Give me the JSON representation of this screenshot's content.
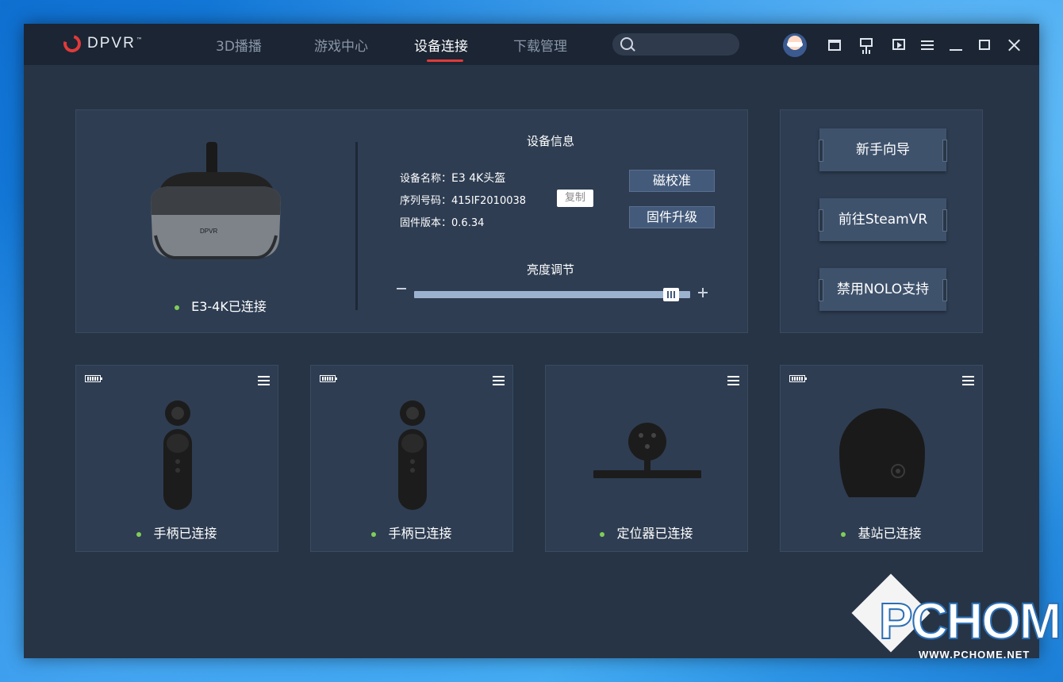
{
  "app": {
    "logo_text": "DPVR",
    "logo_tm": "™",
    "nav_tabs": [
      {
        "label": "3D播播",
        "active": false
      },
      {
        "label": "游戏中心",
        "active": false
      },
      {
        "label": "设备连接",
        "active": true
      },
      {
        "label": "下载管理",
        "active": false
      }
    ],
    "search_placeholder": "",
    "toolbar_icons": [
      "avatar",
      "folder-icon",
      "monitor-icon",
      "play-icon",
      "menu-icon",
      "minimize-icon",
      "maximize-icon",
      "close-icon"
    ]
  },
  "headset": {
    "status": "E3-4K已连接",
    "info_title": "设备信息",
    "name_label": "设备名称：",
    "name_value": "E3 4K头盔",
    "serial_label": "序列号码：",
    "serial_value": "415IF2010038",
    "copy_label": "复制",
    "firmware_label": "固件版本：",
    "firmware_value": "0.6.34",
    "calibrate_label": "磁校准",
    "upgrade_label": "固件升级",
    "brightness_title": "亮度调节",
    "brightness_level": 0.96
  },
  "side_buttons": [
    "新手向导",
    "前往SteamVR",
    "禁用NOLO支持"
  ],
  "devices": [
    {
      "status": "手柄已连接",
      "type": "controller",
      "battery": true
    },
    {
      "status": "手柄已连接",
      "type": "controller",
      "battery": true
    },
    {
      "status": "定位器已连接",
      "type": "tracker",
      "battery": false
    },
    {
      "status": "基站已连接",
      "type": "base-station",
      "battery": true
    }
  ],
  "watermark": {
    "text": "PCHOME",
    "url": "WWW.PCHOME.NET"
  },
  "colors": {
    "accent": "#e03a3a",
    "status_green": "#7fce58",
    "panel": "#2e3d52",
    "button": "#435a7a"
  }
}
